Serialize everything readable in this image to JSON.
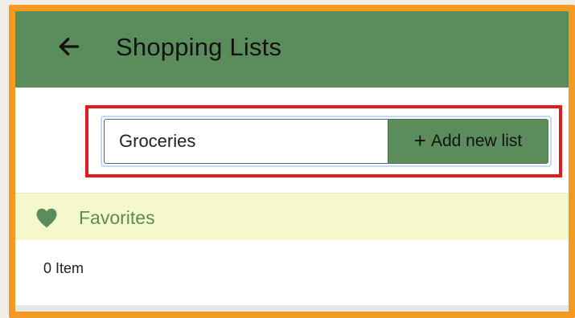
{
  "header": {
    "title": "Shopping Lists",
    "back_icon": "arrow-left-icon"
  },
  "new_list": {
    "input_value": "Groceries",
    "button_label": "Add new list",
    "button_icon": "+"
  },
  "favorites": {
    "label": "Favorites",
    "icon": "heart-icon"
  },
  "list": {
    "count_label": "0 Item"
  },
  "colors": {
    "header": "#5b8c5c",
    "frame": "#f39a24",
    "highlight": "#e21b1b",
    "favorites_bg": "#f5f7cd"
  }
}
